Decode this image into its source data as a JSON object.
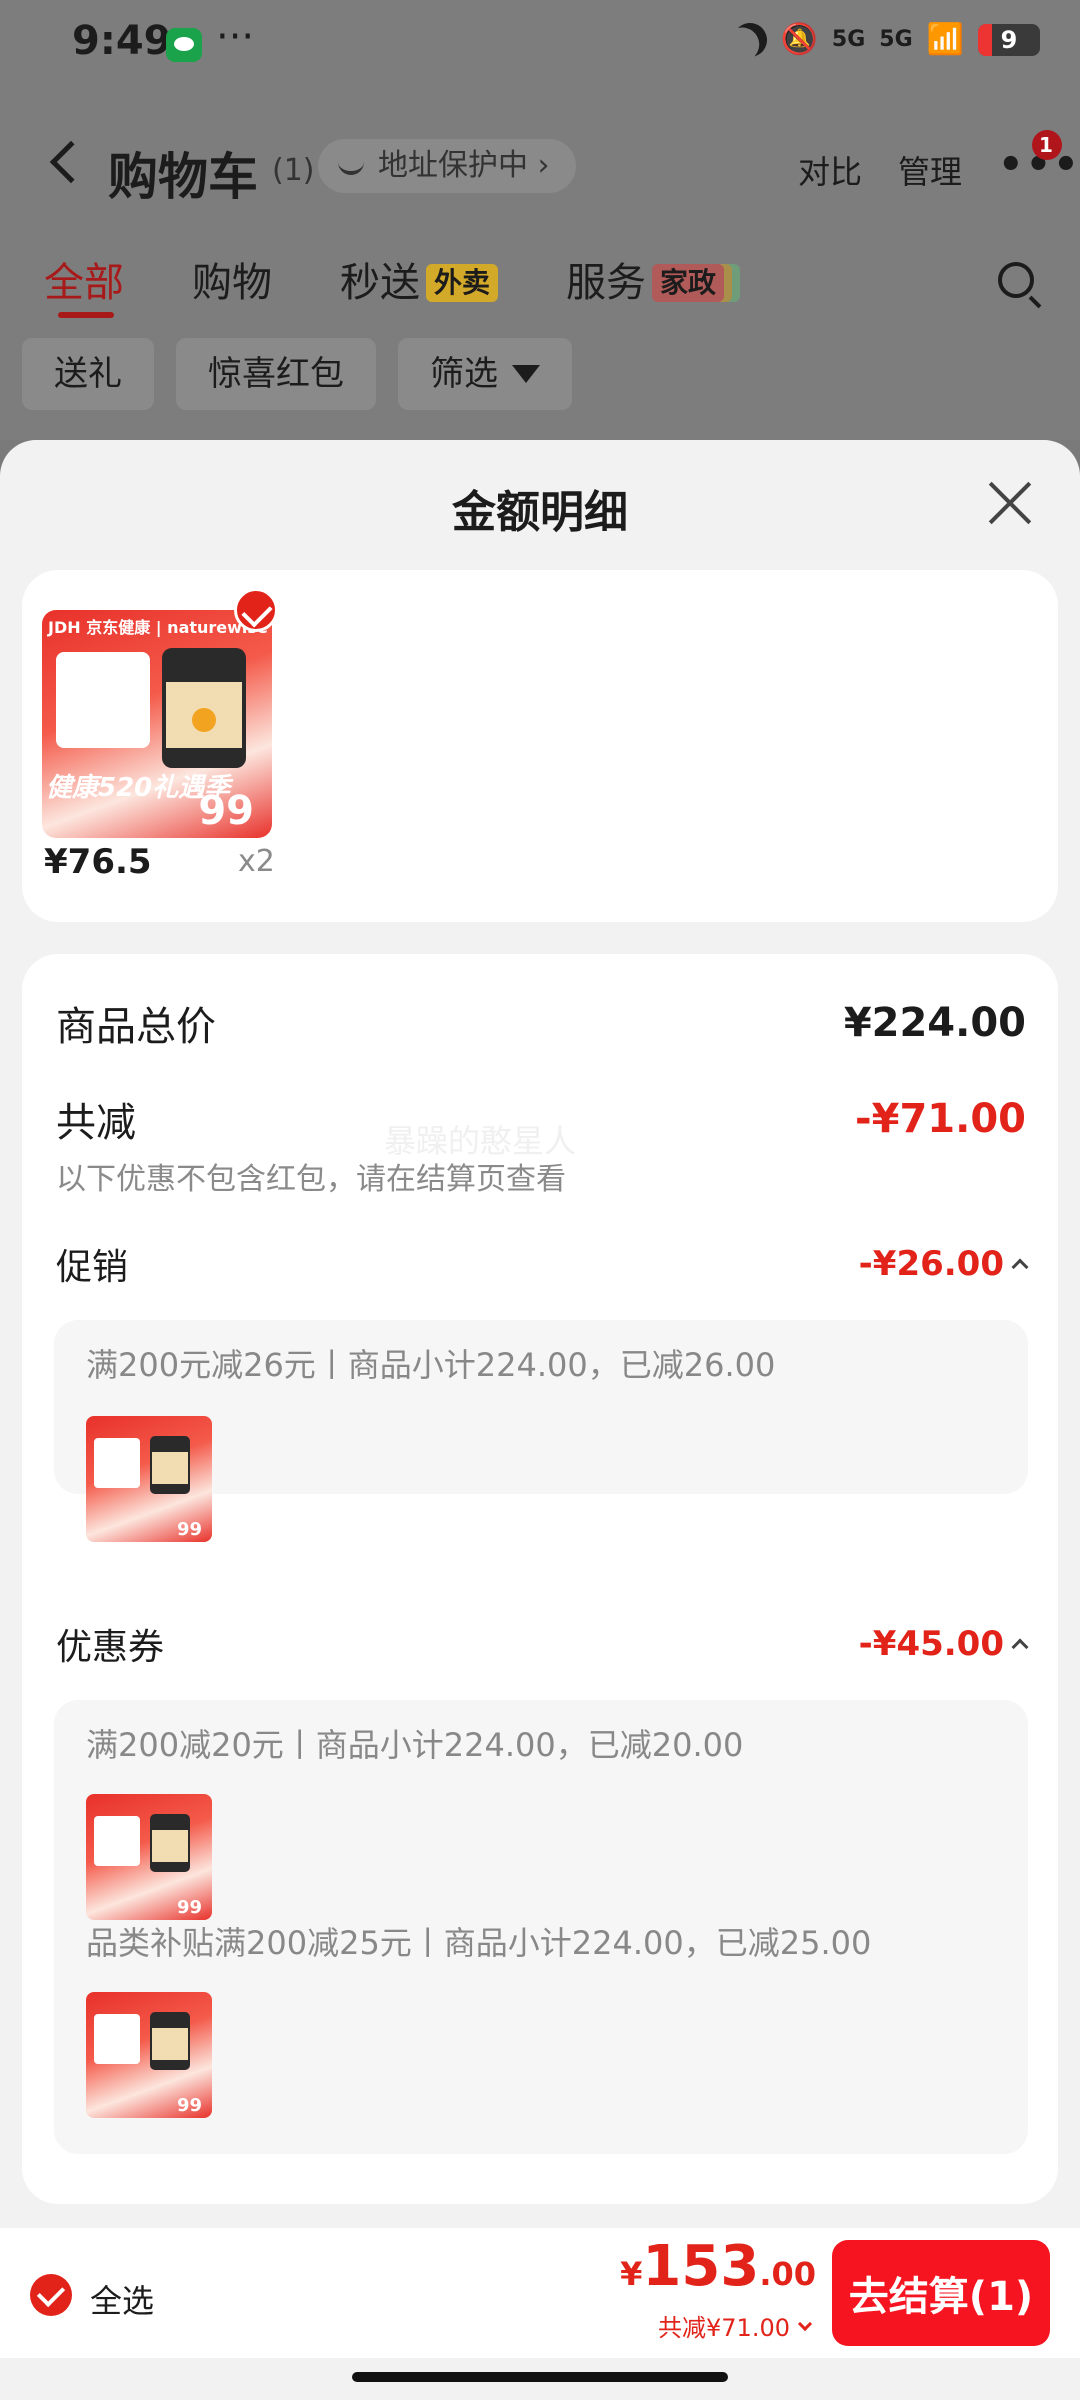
{
  "status_bar": {
    "time": "9:49",
    "dots": "···",
    "signal_1": "5G",
    "signal_2": "5G",
    "battery": "9"
  },
  "header": {
    "title": "购物车",
    "count": "(1)",
    "address_pill": "地址保护中 ›",
    "compare": "对比",
    "manage": "管理",
    "more_badge": "1"
  },
  "tabs": [
    {
      "label": "全部"
    },
    {
      "label": "购物"
    },
    {
      "label": "秒送",
      "tag": "外卖"
    },
    {
      "label": "服务",
      "tag": "家政"
    }
  ],
  "chips": {
    "gift": "送礼",
    "red_packet": "惊喜红包",
    "filter": "筛选"
  },
  "sheet": {
    "title": "金额明细",
    "product": {
      "brand": "JDH 京东健康 | naturewise",
      "promo": "健康520礼遇季",
      "badge_number": "99",
      "price": "¥76.5",
      "qty": "x2"
    },
    "total_label": "商品总价",
    "total_value": "¥224.00",
    "discount_label": "共减",
    "discount_value": "-¥71.00",
    "discount_note": "以下优惠不包含红包，请在结算页查看",
    "watermark": "暴躁的憨星人",
    "promotion": {
      "label": "促销",
      "value": "-¥26.00",
      "lines": [
        "满200元减26元丨商品小计224.00，已减26.00"
      ]
    },
    "coupon": {
      "label": "优惠券",
      "value": "-¥45.00",
      "lines": [
        "满200减20元丨商品小计224.00，已减20.00",
        "品类补贴满200减25元丨商品小计224.00，已减25.00"
      ]
    }
  },
  "bottom_bar": {
    "select_all": "全选",
    "yen": "¥",
    "total_int": "153",
    "total_dec": ".00",
    "total_save": "共减¥71.00",
    "checkout": "去结算(1)"
  },
  "colors": {
    "accent_red": "#e2231a",
    "checkout_red": "#f5141f"
  }
}
